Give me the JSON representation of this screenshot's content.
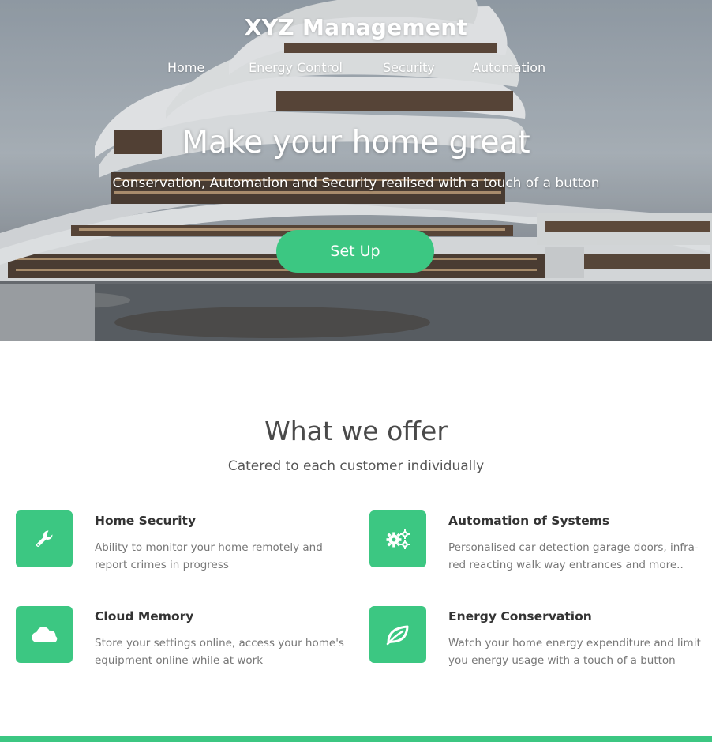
{
  "brand": {
    "name": "XYZ Management"
  },
  "nav": {
    "items": [
      {
        "label": "Home"
      },
      {
        "label": "Energy Control"
      },
      {
        "label": "Security"
      },
      {
        "label": "Automation"
      }
    ]
  },
  "hero": {
    "title": "Make your home great",
    "subtitle": "Conservation, Automation and Security realised with a touch of a button",
    "cta_label": "Set Up"
  },
  "offer": {
    "title": "What we offer",
    "subtitle": "Catered to each customer individually",
    "features": [
      {
        "icon": "wrench-icon",
        "title": "Home Security",
        "description": "Ability to monitor your home remotely and report crimes in progress"
      },
      {
        "icon": "gears-icon",
        "title": "Automation of Systems",
        "description": "Personalised car detection garage doors, infra-red reacting walk way entrances and more.."
      },
      {
        "icon": "cloud-icon",
        "title": "Cloud Memory",
        "description": "Store your settings online, access your home's equipment online while at work"
      },
      {
        "icon": "leaf-icon",
        "title": "Energy Conservation",
        "description": "Watch your home energy expenditure and limit you energy usage with a touch of a button"
      }
    ]
  },
  "colors": {
    "accent": "#3cc782",
    "heading": "#4a4a4a",
    "muted": "#777777"
  }
}
